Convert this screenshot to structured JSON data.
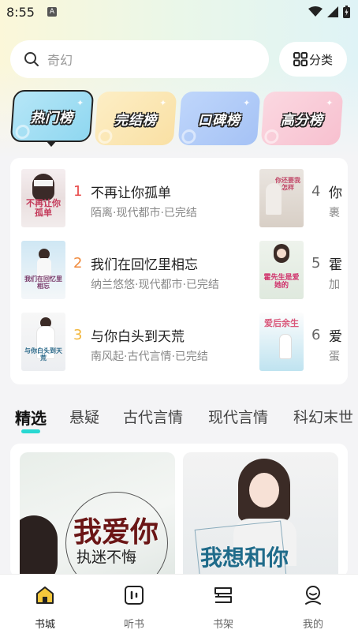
{
  "status": {
    "time": "8:55",
    "notification_letter": "A"
  },
  "search": {
    "placeholder": "奇幻",
    "category_label": "分类"
  },
  "rank_tabs": [
    {
      "label": "热门榜",
      "color": "#8fd7f0",
      "active": true
    },
    {
      "label": "完结榜",
      "color": "#f9e0a4"
    },
    {
      "label": "口碑榜",
      "color": "#a5c2f5"
    },
    {
      "label": "高分榜",
      "color": "#f7c0cf"
    }
  ],
  "books": [
    {
      "rank": "1",
      "title": "不再让你孤单",
      "meta": "陌离·现代都市·已完结",
      "cover_text": "不再让你孤单",
      "rank_color": "#e94b4b"
    },
    {
      "rank": "2",
      "title": "我们在回忆里相忘",
      "meta": "纳兰悠悠·现代都市·已完结",
      "cover_text": "我们在回忆里相忘",
      "rank_color": "#f08a3c"
    },
    {
      "rank": "3",
      "title": "与你白头到天荒",
      "meta": "南风起·古代言情·已完结",
      "cover_text": "与你白头到天荒",
      "rank_color": "#f2b63b"
    },
    {
      "rank": "4",
      "title": "你",
      "meta": "裹",
      "cover_text": "你还要我怎样",
      "rank_color": "#666666"
    },
    {
      "rank": "5",
      "title": "霍",
      "meta": "加",
      "cover_text": "霍先生是爱她的",
      "rank_color": "#666666"
    },
    {
      "rank": "6",
      "title": "爱",
      "meta": "蛋",
      "cover_text": "爱后余生",
      "rank_color": "#666666"
    }
  ],
  "genre_tabs": [
    "精选",
    "悬疑",
    "古代言情",
    "现代言情",
    "科幻末世"
  ],
  "featured": [
    {
      "title": "我爱你",
      "subtitle": "执迷不悔"
    },
    {
      "title": "我想和你"
    }
  ],
  "nav": [
    {
      "label": "书城",
      "icon": "bookstore-icon",
      "active": true
    },
    {
      "label": "听书",
      "icon": "audiobook-icon"
    },
    {
      "label": "书架",
      "icon": "bookshelf-icon"
    },
    {
      "label": "我的",
      "icon": "profile-icon"
    }
  ],
  "colors": {
    "accent": "#29d8d2",
    "nav_active": "#f5c73b"
  }
}
